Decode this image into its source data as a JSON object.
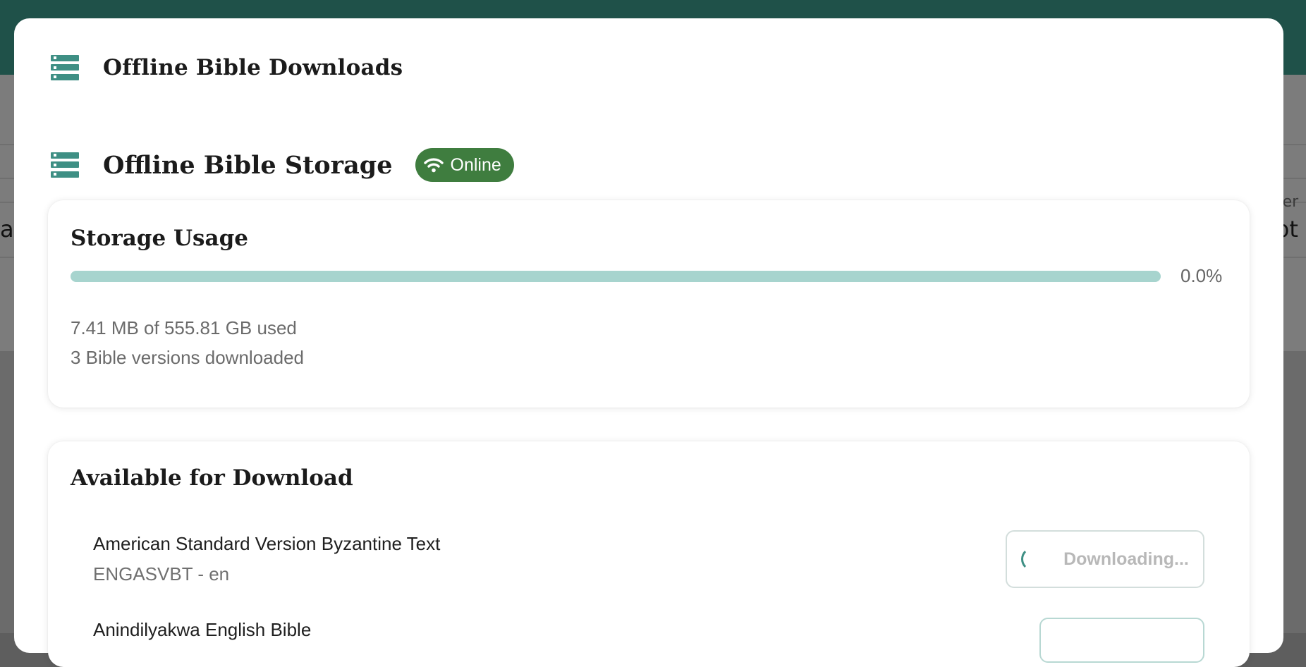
{
  "modal": {
    "title": "Offline Bible Downloads",
    "section_title": "Offline Bible Storage",
    "status_badge": "Online"
  },
  "storage": {
    "title": "Storage Usage",
    "percent_label": "0.0%",
    "fraction": 0.0,
    "used_text": "7.41 MB of 555.81 GB used",
    "versions_text": "3 Bible versions downloaded"
  },
  "downloads": {
    "title": "Available for Download",
    "items": [
      {
        "name": "American Standard Version Byzantine Text",
        "meta": "ENGASVBT - en",
        "button": "Downloading..."
      },
      {
        "name": "Anindilyakwa English Bible",
        "meta": "",
        "button": ""
      }
    ]
  },
  "colors": {
    "accent": "#3e8f84",
    "badge": "#3f7d3f",
    "progress": "#a7d4ce",
    "header_bg": "#1f5149"
  },
  "background": {
    "left_fragment": "ar",
    "right_small_fragment": "ter",
    "right_fragment": "pt"
  }
}
